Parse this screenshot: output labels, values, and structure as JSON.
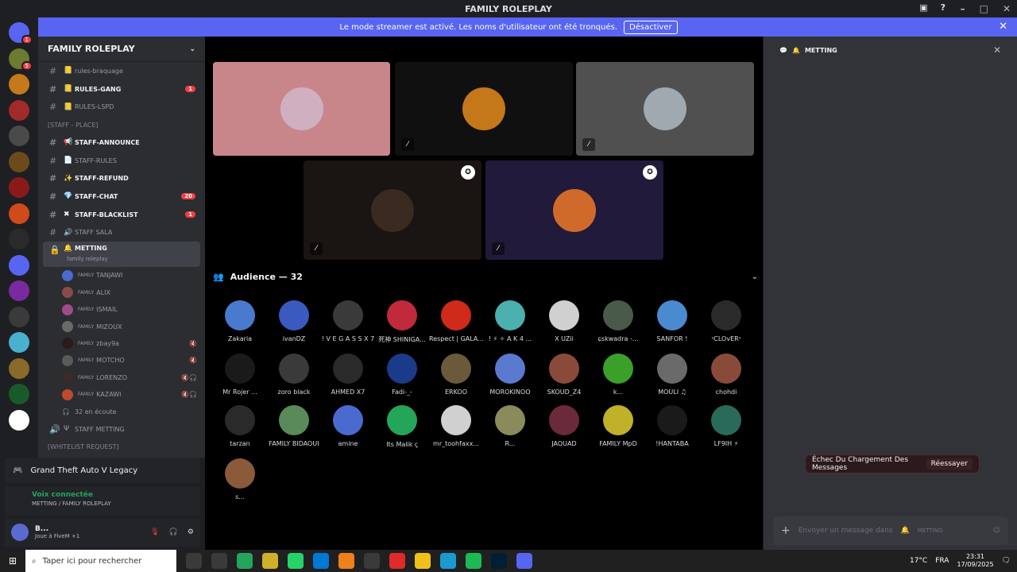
{
  "window": {
    "title": "FAMILY ROLEPLAY"
  },
  "banner": {
    "text": "Le mode streamer est activé. Les noms d'utilisateur ont été tronqués.",
    "button": "Désactiver"
  },
  "servers": [
    {
      "color": "#5865f2",
      "badge": "1"
    },
    {
      "color": "#6b7b2f",
      "badge": "5"
    },
    {
      "color": "#c47a1a",
      "badge": ""
    },
    {
      "color": "#a12a2a",
      "badge": ""
    },
    {
      "color": "#4a4a4a",
      "badge": ""
    },
    {
      "color": "#6b4b1a",
      "badge": ""
    },
    {
      "color": "#8a1a1a",
      "badge": ""
    },
    {
      "color": "#d04a1a",
      "badge": ""
    },
    {
      "color": "#2a2a2a",
      "badge": ""
    },
    {
      "color": "#5865f2",
      "badge": ""
    },
    {
      "color": "#7a2aa0",
      "badge": ""
    },
    {
      "color": "#3a3a3a",
      "badge": ""
    },
    {
      "color": "#4ab0d0",
      "badge": ""
    },
    {
      "color": "#8a6a2a",
      "badge": ""
    },
    {
      "color": "#1a5a2a",
      "badge": ""
    },
    {
      "color": "#ffffff",
      "badge": ""
    }
  ],
  "guild": {
    "name": "FAMILY ROLEPLAY"
  },
  "channels": [
    {
      "label": "rules-braquage",
      "icon": "📒",
      "bold": false,
      "badge": ""
    },
    {
      "label": "RULES-GANG",
      "icon": "📒",
      "bold": true,
      "badge": "1"
    },
    {
      "label": "RULES-LSPD",
      "icon": "📒",
      "bold": false,
      "badge": ""
    }
  ],
  "category_staff": "[STAFF - PLACE]",
  "staff_channels": [
    {
      "label": "STAFF-ANNOUNCE",
      "icon": "📢",
      "bold": true,
      "badge": ""
    },
    {
      "label": "STAFF-RULES",
      "icon": "📄",
      "bold": false,
      "badge": ""
    },
    {
      "label": "STAFF-REFUND",
      "icon": "✨",
      "bold": true,
      "badge": ""
    },
    {
      "label": "STAFF-CHAT",
      "icon": "💎",
      "bold": true,
      "badge": "20"
    },
    {
      "label": "STAFF-BLACKLIST",
      "icon": "✖",
      "bold": true,
      "badge": "1"
    },
    {
      "label": "STAFF SALA",
      "icon": "🔊",
      "bold": false,
      "badge": ""
    }
  ],
  "selected_channel": {
    "label": "METTING",
    "sub": "family roleplay"
  },
  "voice_users": [
    {
      "name": "TANJAWI",
      "prefix": "FAMILY",
      "color": "#4a6ad0",
      "mic": ""
    },
    {
      "name": "ALIX",
      "prefix": "FAMILY",
      "color": "#8a4a4a",
      "mic": ""
    },
    {
      "name": "ISMAIL",
      "prefix": "FAMILY",
      "color": "#a04a8a",
      "mic": ""
    },
    {
      "name": "MIZOUX",
      "prefix": "FAMILY",
      "color": "#6a6a6a",
      "mic": ""
    },
    {
      "name": "zbay9a",
      "prefix": "FAMILY",
      "color": "#2a1a1a",
      "mic": "🔇"
    },
    {
      "name": "MOTCHO",
      "prefix": "FAMILY",
      "color": "#5a5a5a",
      "mic": "🔇"
    },
    {
      "name": "LORENZO",
      "prefix": "FAMILY",
      "color": "#3a2a2a",
      "mic": "🔇🎧"
    },
    {
      "name": "KAZAWI",
      "prefix": "FAMILY",
      "color": "#c04a2a",
      "mic": "🔇🎧"
    }
  ],
  "listening": "32 en écoute",
  "staff_metting": "STAFF METTING",
  "category_whitelist": "[WHITELIST REQUEST]",
  "game": {
    "title": "Grand Theft Auto V Legacy"
  },
  "voice": {
    "status": "Voix connectée",
    "location": "METTING / FAMILY ROLEPLAY"
  },
  "me": {
    "name": "B...",
    "status": "Joue à FiveM +1"
  },
  "stage_tiles": [
    {
      "bg": "#c9868a",
      "av": "#d0b0c0",
      "mute": false,
      "stream": false
    },
    {
      "bg": "#101010",
      "av": "#c4781a",
      "mute": true,
      "stream": false
    },
    {
      "bg": "#505050",
      "av": "#a0a8b0",
      "mute": true,
      "stream": false
    },
    {
      "bg": "#1a1512",
      "av": "#3a2a20",
      "mute": true,
      "stream": true
    },
    {
      "bg": "#221a3a",
      "av": "#d06a2a",
      "mute": true,
      "stream": true
    }
  ],
  "audience": {
    "title": "Audience — 32",
    "members": [
      {
        "n": "Zakaria",
        "c": "#4a7ad0"
      },
      {
        "n": "ivanDZ",
        "c": "#3a5ac0"
      },
      {
        "n": "! V E G A S S X 7",
        "c": "#3a3a3a"
      },
      {
        "n": "死神 SHINIGA...",
        "c": "#c02a3a"
      },
      {
        "n": "Respect | GALA...",
        "c": "#d02a1a"
      },
      {
        "n": "! ⚡ ✧ A K 4 ...",
        "c": "#4ab0b0"
      },
      {
        "n": "X UZii",
        "c": "#d0d0d0"
      },
      {
        "n": "ɕskwadra -...",
        "c": "#4a5a4a"
      },
      {
        "n": "SANFOR !",
        "c": "#4a8ad0"
      },
      {
        "n": "ˢCLOᴠERˢ",
        "c": "#2a2a2a"
      },
      {
        "n": "Mr Rojer ...",
        "c": "#1a1a1a"
      },
      {
        "n": "zoro black",
        "c": "#3a3a3a"
      },
      {
        "n": "AHMED X7",
        "c": "#2a2a2a"
      },
      {
        "n": "Fadi-_-",
        "c": "#1a3a8a"
      },
      {
        "n": "ERKOO",
        "c": "#6a5a3a"
      },
      {
        "n": "MOROKINOO",
        "c": "#5a7ad0"
      },
      {
        "n": "SKOUD_Z4",
        "c": "#8a4a3a"
      },
      {
        "n": "k...",
        "c": "#3aa02a"
      },
      {
        "n": "MOULI ♫",
        "c": "#6a6a6a"
      },
      {
        "n": "chohdi",
        "c": "#8a4a3a"
      },
      {
        "n": "tarzan",
        "c": "#2a2a2a"
      },
      {
        "n": "FAMILY BIDAOUI",
        "c": "#5a8a5a"
      },
      {
        "n": "amine",
        "c": "#4a6ad0"
      },
      {
        "n": "Its Malik ꞔ",
        "c": "#23a55a"
      },
      {
        "n": "mr_toohfaxx...",
        "c": "#d0d0d0"
      },
      {
        "n": "R...",
        "c": "#8a8a5a"
      },
      {
        "n": "JAOUAD",
        "c": "#6a2a3a"
      },
      {
        "n": "FAMILY MpD",
        "c": "#c0b02a"
      },
      {
        "n": "!HANTABA",
        "c": "#1a1a1a"
      },
      {
        "n": "LF9IH ⚡",
        "c": "#2a6a5a"
      },
      {
        "n": "s...",
        "c": "#8a5a3a"
      }
    ]
  },
  "right": {
    "channel": "METTING",
    "error": "Échec Du Chargement Des Messages",
    "retry": "Réessayer",
    "placeholder": "Envoyer un message dans",
    "channel_small": "METTING"
  },
  "taskbar": {
    "search": "Taper ici pour rechercher",
    "temp": "17°C",
    "lang": "FRA",
    "time": "23:31",
    "date": "17/09/2025"
  }
}
